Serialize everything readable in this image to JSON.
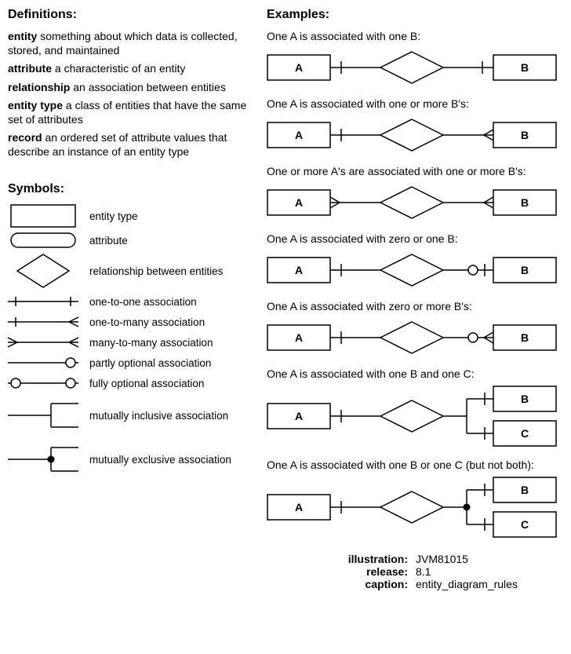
{
  "definitions_heading": "Definitions:",
  "definitions": [
    {
      "term": "entity",
      "def": "something about which data is collected, stored, and maintained"
    },
    {
      "term": "attribute",
      "def": "a characteristic of an entity"
    },
    {
      "term": "relationship",
      "def": "an association between entities"
    },
    {
      "term": "entity type",
      "def": "a class of entities that have the same set of attributes"
    },
    {
      "term": "record",
      "def": "an ordered set of attribute values that describe an instance of an entity type"
    }
  ],
  "symbols_heading": "Symbols:",
  "symbols": [
    {
      "label": "entity type"
    },
    {
      "label": "attribute"
    },
    {
      "label": "relationship between entities"
    },
    {
      "label": "one-to-one association"
    },
    {
      "label": "one-to-many association"
    },
    {
      "label": "many-to-many association"
    },
    {
      "label": "partly optional association"
    },
    {
      "label": "fully optional association"
    },
    {
      "label": "mutually inclusive association"
    },
    {
      "label": "mutually exclusive association"
    }
  ],
  "examples_heading": "Examples:",
  "examples": [
    {
      "caption": "One A is associated with one B:",
      "labelA": "A",
      "labelB": "B"
    },
    {
      "caption": "One A is associated with one or more B's:",
      "labelA": "A",
      "labelB": "B"
    },
    {
      "caption": "One or more A's are associated with one or more B's:",
      "labelA": "A",
      "labelB": "B"
    },
    {
      "caption": "One A is associated with zero or one B:",
      "labelA": "A",
      "labelB": "B"
    },
    {
      "caption": "One A is associated with zero or more B's:",
      "labelA": "A",
      "labelB": "B"
    },
    {
      "caption": "One A is associated with one B and one C:",
      "labelA": "A",
      "labelB": "B",
      "labelC": "C"
    },
    {
      "caption": "One A is associated with one B or one C (but not both):",
      "labelA": "A",
      "labelB": "B",
      "labelC": "C"
    }
  ],
  "footer": {
    "illustration_label": "illustration:",
    "illustration": "JVM81015",
    "release_label": "release:",
    "release": "8.1",
    "caption_label": "caption:",
    "caption": "entity_diagram_rules"
  }
}
